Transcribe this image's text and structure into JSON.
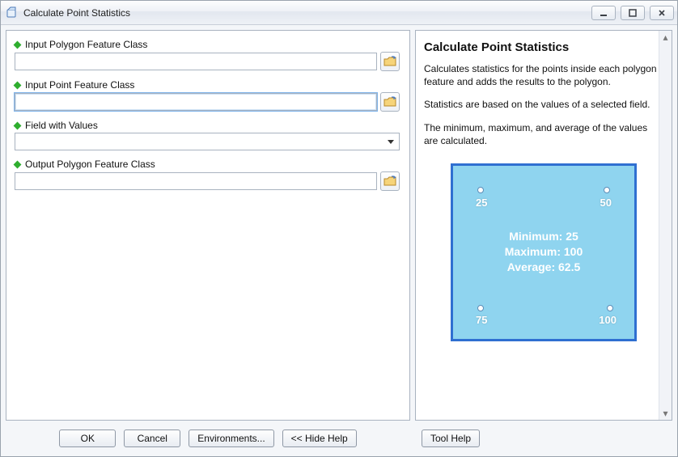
{
  "window": {
    "title": "Calculate Point Statistics"
  },
  "params": {
    "polygon_in": {
      "label": "Input Polygon Feature Class",
      "value": ""
    },
    "point_in": {
      "label": "Input Point Feature Class",
      "value": ""
    },
    "field": {
      "label": "Field with Values",
      "value": ""
    },
    "polygon_out": {
      "label": "Output Polygon Feature Class",
      "value": ""
    }
  },
  "help": {
    "title": "Calculate Point Statistics",
    "para1": "Calculates statistics for the points inside each polygon feature and adds the results to the polygon.",
    "para2": "Statistics are based on the values of a selected field.",
    "para3": "The minimum, maximum, and average of the values are calculated.",
    "diagram": {
      "tl": "25",
      "tr": "50",
      "bl": "75",
      "br": "100",
      "line1": "Minimum: 25",
      "line2": "Maximum: 100",
      "line3": "Average: 62.5"
    }
  },
  "buttons": {
    "ok": "OK",
    "cancel": "Cancel",
    "environments": "Environments...",
    "hide_help": "<< Hide Help",
    "tool_help": "Tool Help"
  }
}
